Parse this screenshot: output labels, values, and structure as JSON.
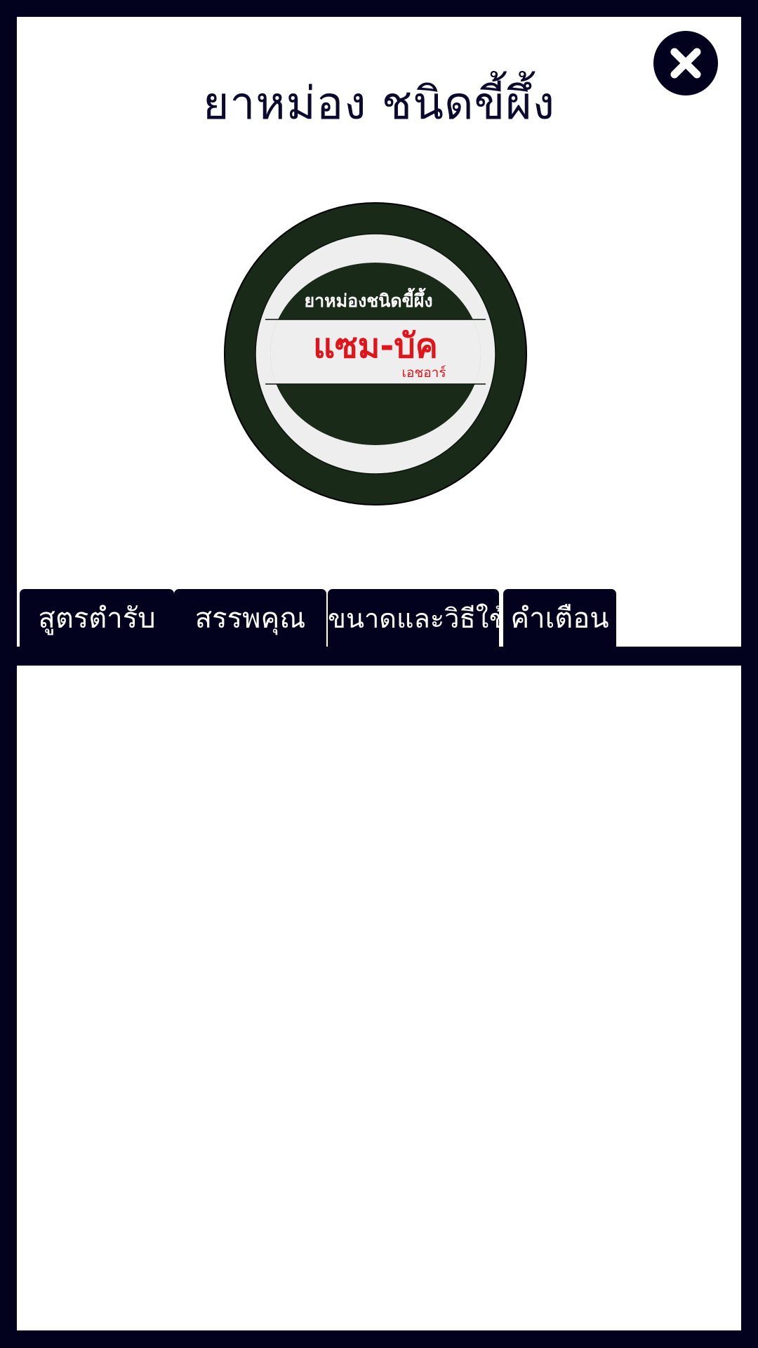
{
  "page": {
    "title": "ยาหม่อง ชนิดขี้ผึ้ง"
  },
  "close_button": {
    "icon": "close-icon"
  },
  "logo": {
    "line1": "ยาหม่องชนิดขี้ผึ้ง",
    "brand": "แซม-บัค",
    "line3": "เอชอาร์",
    "colors": {
      "ring": "#192b18",
      "inner": "#efeeef",
      "brand_text": "#e0141b"
    }
  },
  "tabs": [
    {
      "label": "สูตรตำรับ"
    },
    {
      "label": "สรรพคุณ"
    },
    {
      "label": "ขนาดและวิธีใช้"
    },
    {
      "label": "คำเตือน"
    }
  ],
  "colors": {
    "frame": "#03021e",
    "panel": "#ffffff"
  }
}
